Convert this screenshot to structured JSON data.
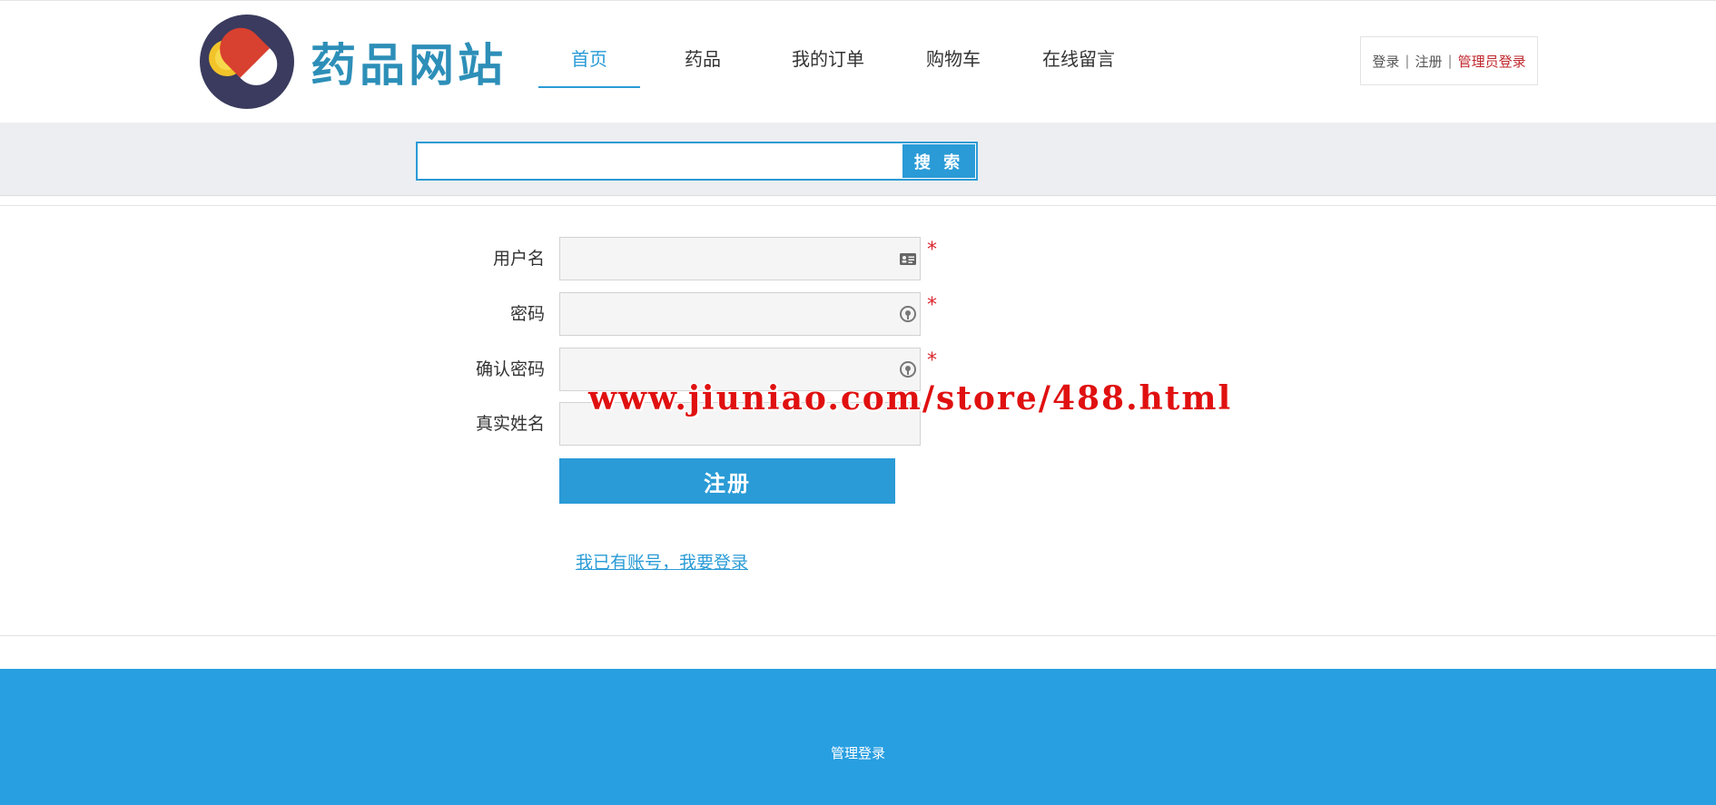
{
  "header": {
    "site_name": "药品网站",
    "logo_icon": "pill-capsule-icon",
    "nav": [
      {
        "label": "首页",
        "active": true
      },
      {
        "label": "药品",
        "active": false
      },
      {
        "label": "我的订单",
        "active": false
      },
      {
        "label": "购物车",
        "active": false
      },
      {
        "label": "在线留言",
        "active": false
      }
    ],
    "auth": {
      "login": "登录",
      "register": "注册",
      "admin_login": "管理员登录",
      "separator": "|"
    }
  },
  "search": {
    "value": "",
    "placeholder": "",
    "button_label": "搜 索"
  },
  "form": {
    "fields": [
      {
        "label": "用户名",
        "value": "",
        "icon": "id-card-icon",
        "required": true
      },
      {
        "label": "密码",
        "value": "",
        "icon": "lock-icon",
        "required": true
      },
      {
        "label": "确认密码",
        "value": "",
        "icon": "lock-icon",
        "required": true
      },
      {
        "label": "真实姓名",
        "value": "",
        "icon": "",
        "required": false
      }
    ],
    "required_mark": "*",
    "submit_label": "注册",
    "login_link": "我已有账号，我要登录"
  },
  "watermark": "www.jiuniao.com/store/488.html",
  "footer": {
    "admin_link": "管理登录"
  },
  "colors": {
    "accent": "#2a9bd6",
    "footer_bg": "#289fe1",
    "required": "#d9262e",
    "admin_link": "#c0282e"
  }
}
